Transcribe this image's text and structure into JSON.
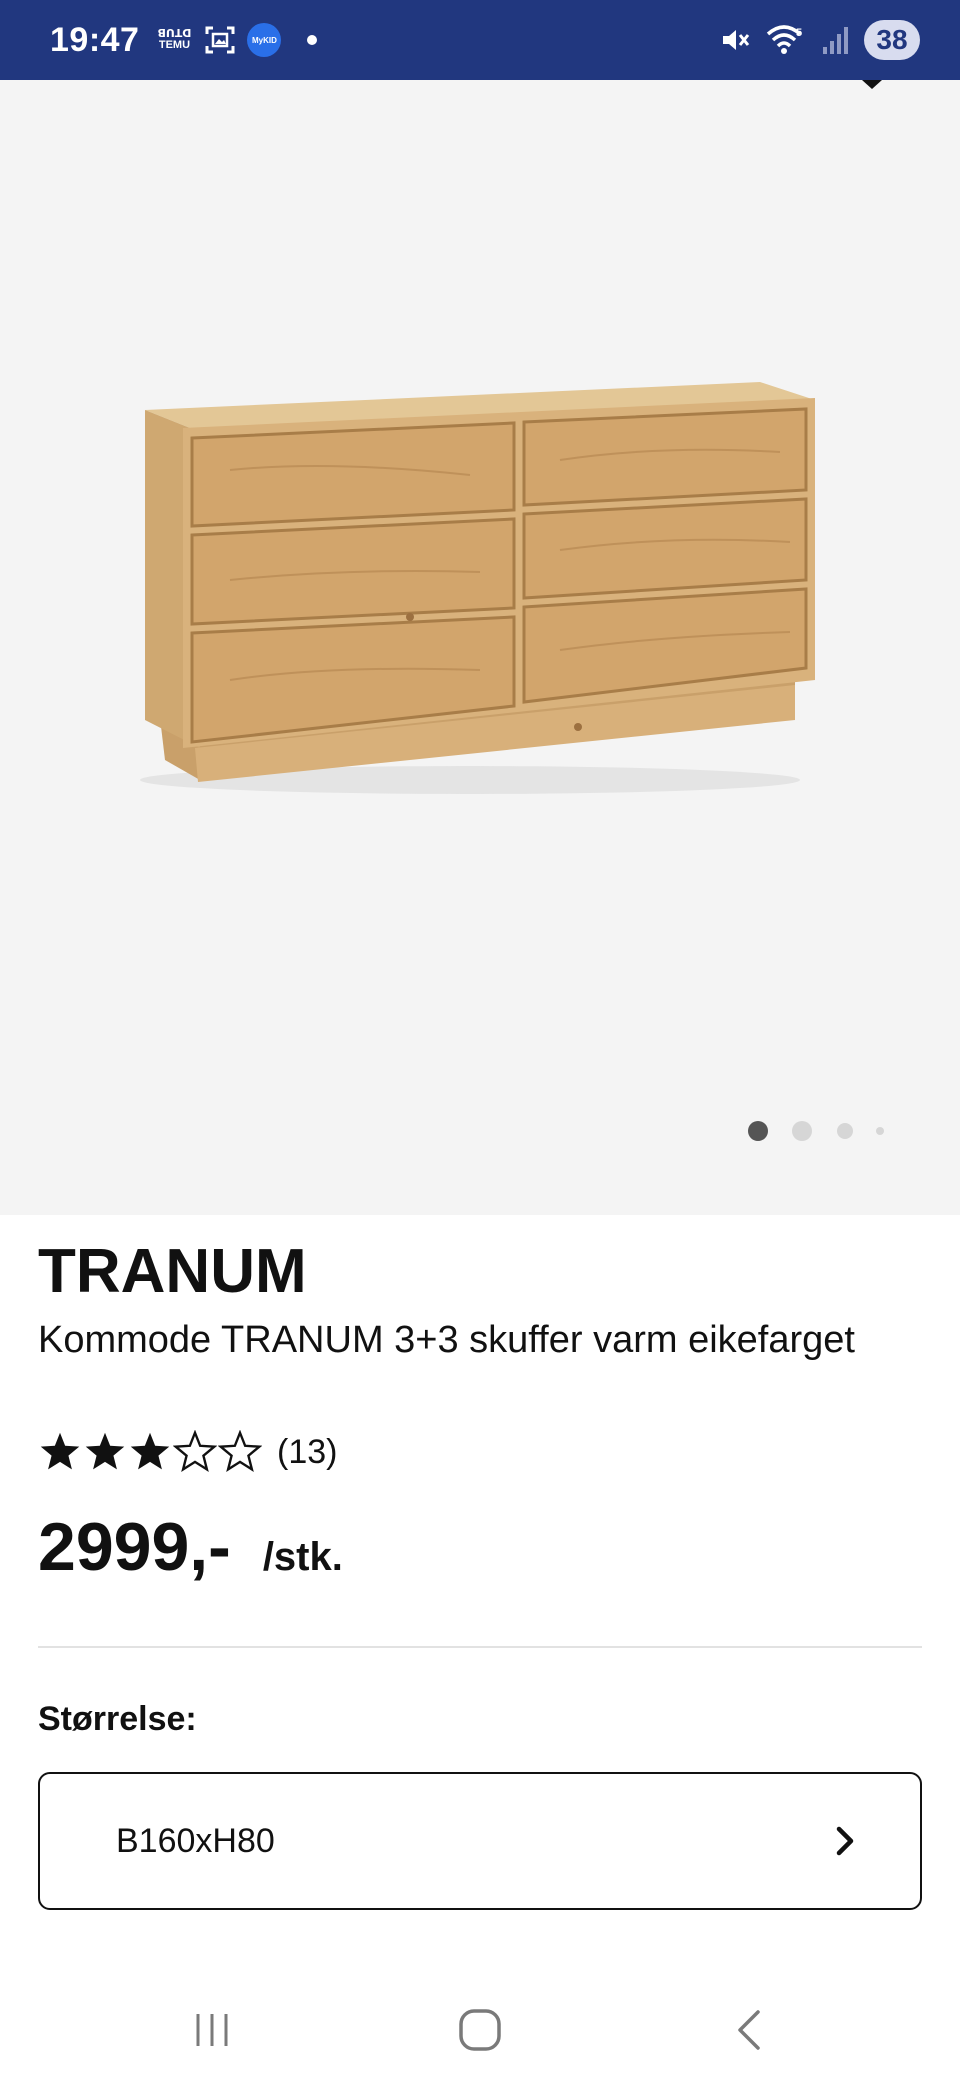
{
  "status_bar": {
    "time": "19:47",
    "temu_label": "TEMU",
    "mykid_label": "MyKID",
    "battery": "38",
    "background_color": "#21377f"
  },
  "gallery": {
    "image_alt_name": "dresser-image",
    "dots_count": 4,
    "active_index": 0
  },
  "product": {
    "brand": "TRANUM",
    "description": "Kommode TRANUM 3+3 skuffer varm eikefarget",
    "rating": {
      "stars_filled": 3,
      "stars_total": 5,
      "count_label": "(13)"
    },
    "price": "2999,-",
    "price_unit": "/stk."
  },
  "size": {
    "label": "Størrelse:",
    "selected": "B160xH80"
  },
  "icons": {
    "mute": "mute-icon",
    "wifi": "wifi-icon",
    "signal": "signal-icon",
    "chevron": "chevron-right-icon",
    "nav_recent": "recent-apps-icon",
    "nav_home": "home-icon",
    "nav_back": "back-icon"
  }
}
